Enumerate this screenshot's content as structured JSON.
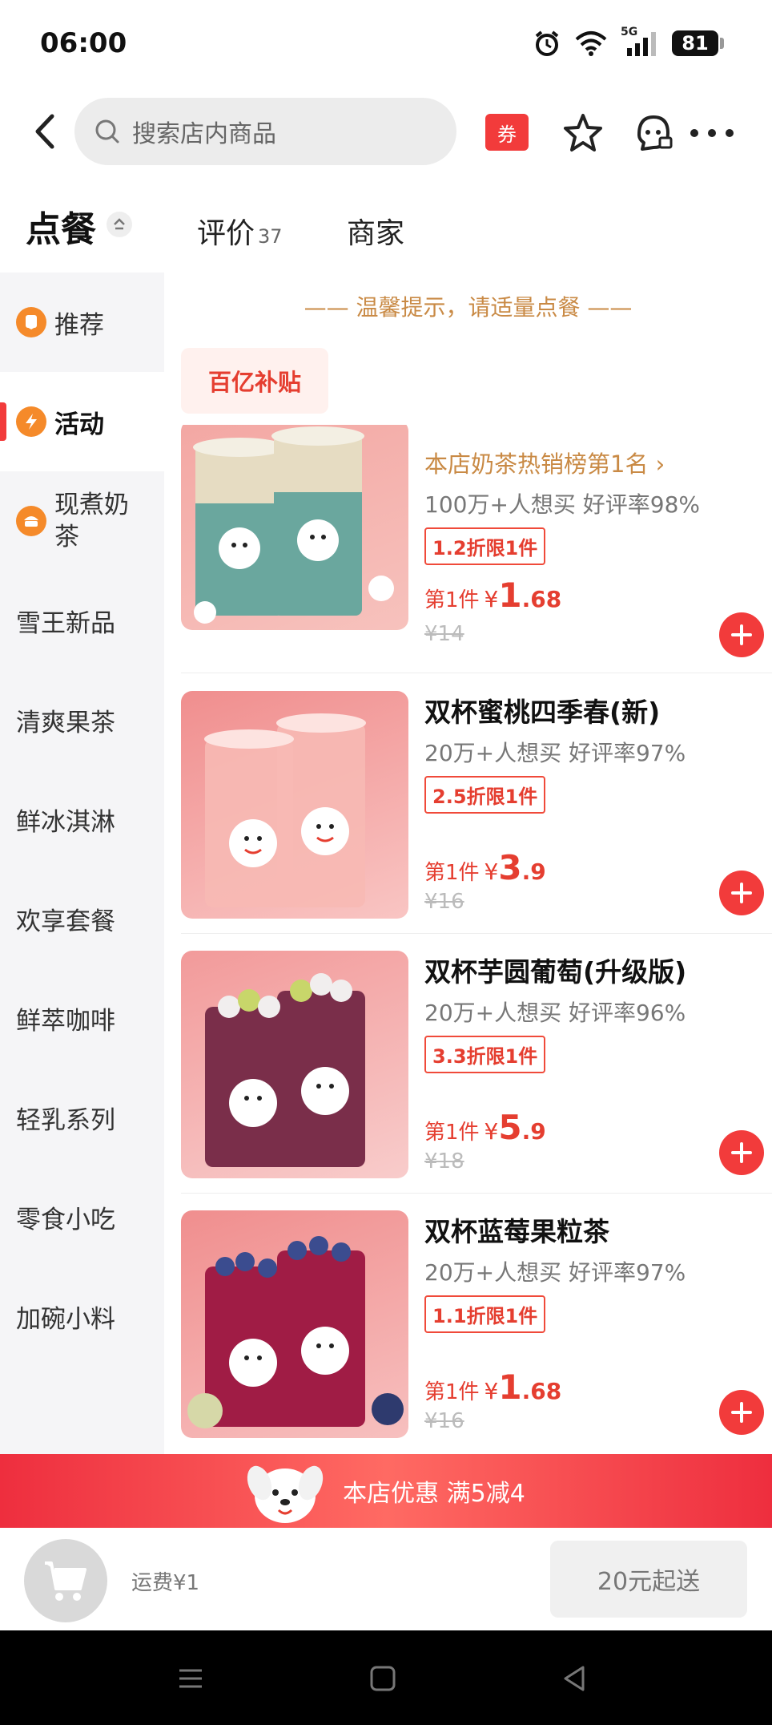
{
  "status_bar": {
    "time": "06:00",
    "network": "5G",
    "battery": "81"
  },
  "header": {
    "search_placeholder": "搜索店内商品",
    "coupon_label": "券"
  },
  "tabs": {
    "order": "点餐",
    "review": "评价",
    "review_count": "37",
    "merchant": "商家"
  },
  "sidebar": {
    "items": [
      {
        "label": "推荐"
      },
      {
        "label": "活动"
      },
      {
        "label": "现煮奶茶"
      },
      {
        "label": "雪王新品"
      },
      {
        "label": "清爽果茶"
      },
      {
        "label": "鲜冰淇淋"
      },
      {
        "label": "欢享套餐"
      },
      {
        "label": "鲜萃咖啡"
      },
      {
        "label": "轻乳系列"
      },
      {
        "label": "零食小吃"
      },
      {
        "label": "加碗小料"
      }
    ]
  },
  "main": {
    "notice": "—— 温馨提示，请适量点餐 ——",
    "subsidy_tag": "百亿补贴",
    "products": [
      {
        "rank": "本店奶茶热销榜第1名 ›",
        "stats": "100万+人想买  好评率98%",
        "discount": "1.2折限1件",
        "price_prefix": "第1件",
        "price_symbol": "¥",
        "price_main": "1",
        "price_decimal": ".68",
        "original_price": "¥14"
      },
      {
        "title": "双杯蜜桃四季春(新)",
        "stats": "20万+人想买  好评率97%",
        "discount": "2.5折限1件",
        "price_prefix": "第1件",
        "price_symbol": "¥",
        "price_main": "3",
        "price_decimal": ".9",
        "original_price": "¥16"
      },
      {
        "title": "双杯芋圆葡萄(升级版)",
        "stats": "20万+人想买  好评率96%",
        "discount": "3.3折限1件",
        "price_prefix": "第1件",
        "price_symbol": "¥",
        "price_main": "5",
        "price_decimal": ".9",
        "original_price": "¥18"
      },
      {
        "title": "双杯蓝莓果粒茶",
        "stats": "20万+人想买  好评率97%",
        "discount": "1.1折限1件",
        "price_prefix": "第1件",
        "price_symbol": "¥",
        "price_main": "1",
        "price_decimal": ".68",
        "original_price": "¥16"
      }
    ]
  },
  "promo": {
    "text": "本店优惠  满5减4"
  },
  "cart": {
    "delivery_fee": "运费¥1",
    "min_order": "20元起送"
  },
  "colors": {
    "accent": "#f23b3b",
    "notice": "#c98a45",
    "sidebar_bg": "#f5f5f7"
  }
}
